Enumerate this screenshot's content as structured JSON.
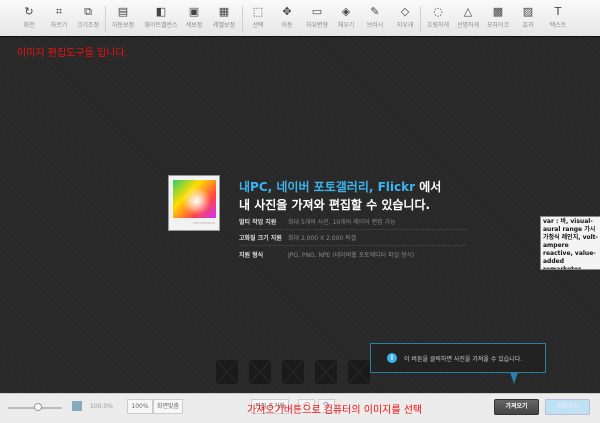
{
  "toolbar": {
    "tools": [
      {
        "label": "회전",
        "icon": "rotate-icon",
        "glyph": "↻"
      },
      {
        "label": "자르기",
        "icon": "crop-icon",
        "glyph": "⌗"
      },
      {
        "label": "크기조정",
        "icon": "resize-icon",
        "glyph": "⧉"
      },
      {
        "label": "자동보정",
        "icon": "auto-correct-icon",
        "glyph": "▤"
      },
      {
        "label": "화이트밸런스",
        "icon": "white-balance-icon",
        "glyph": "◧"
      },
      {
        "label": "색보정",
        "icon": "color-correct-icon",
        "glyph": "▣"
      },
      {
        "label": "레벨보정",
        "icon": "level-correct-icon",
        "glyph": "▦"
      },
      {
        "label": "선택",
        "icon": "select-icon",
        "glyph": "⬚"
      },
      {
        "label": "이동",
        "icon": "move-icon",
        "glyph": "✥"
      },
      {
        "label": "자유변형",
        "icon": "transform-icon",
        "glyph": "▭"
      },
      {
        "label": "채우기",
        "icon": "fill-icon",
        "glyph": "◈"
      },
      {
        "label": "브러시",
        "icon": "brush-icon",
        "glyph": "✎"
      },
      {
        "label": "지우개",
        "icon": "eraser-icon",
        "glyph": "◇"
      },
      {
        "label": "흐릿하게",
        "icon": "blur-icon",
        "glyph": "◌"
      },
      {
        "label": "선명하게",
        "icon": "sharpen-icon",
        "glyph": "△"
      },
      {
        "label": "모자이크",
        "icon": "mosaic-icon",
        "glyph": "▩"
      },
      {
        "label": "효과",
        "icon": "effect-icon",
        "glyph": "▨"
      },
      {
        "label": "텍스트",
        "icon": "text-icon",
        "glyph": "T"
      }
    ]
  },
  "annotations": {
    "top": "이미지 편집도구들 입니다.",
    "bottom": "가져오기버튼으로 컴퓨터의 이미지를 선택"
  },
  "intro": {
    "headline_highlight": "내PC, 네이버 포토갤러리, Flickr",
    "headline_rest": " 에서",
    "headline_line2": "내 사진을 가져와 편집할 수 있습니다.",
    "photo_caption": "PHOTOEDITOR",
    "features": [
      {
        "key": "멀티 작업 지원",
        "value": "최대 5개의 사진, 10개의 레이어 편집 가능"
      },
      {
        "key": "고화질 크기 지원",
        "value": "최대 2,000 X 2,000 픽셀"
      },
      {
        "key": "지원 형식",
        "value": "JPG, PNG, NPE (네이버웹 포토에디터 파일 형식)"
      }
    ]
  },
  "tooltip": "var : 바, visual-aural range 가시 가청식 레인지, volt-ampere reactive, value-added remarketer",
  "callout": {
    "text": "이 버튼을 클릭하면 사진을 가져올 수 있습니다.",
    "accent": "#3cb4f0"
  },
  "bottombar": {
    "zoom_value": "100.0%",
    "zoom_100": "100%",
    "fit_screen": "화면맞춤",
    "reset_edit": "편집 초기화",
    "import": "가져오기",
    "save": "저장하기"
  }
}
